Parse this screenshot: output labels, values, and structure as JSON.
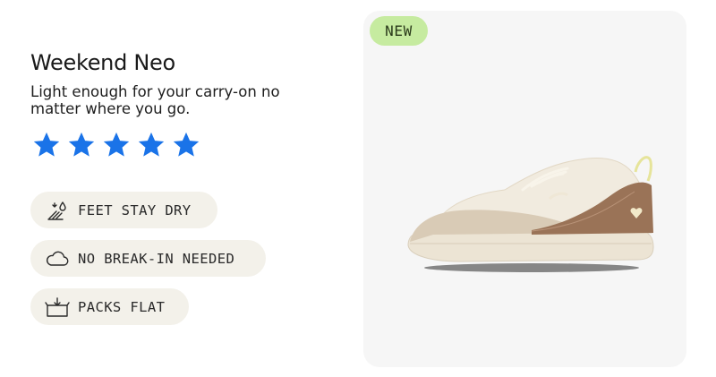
{
  "product": {
    "name": "Weekend Neo",
    "tagline": "Light enough for your carry-on no matter where you go.",
    "rating": {
      "stars": 5,
      "max": 5,
      "color": "#1a73e8"
    },
    "badge": "NEW"
  },
  "features": [
    {
      "icon": "water-drop-icon",
      "label": "FEET STAY DRY"
    },
    {
      "icon": "cloud-icon",
      "label": "NO BREAK-IN NEEDED"
    },
    {
      "icon": "box-icon",
      "label": "PACKS FLAT"
    }
  ],
  "colors": {
    "pill_bg": "#f3f1ea",
    "badge_bg": "#c6eba0",
    "card_bg": "#f6f6f6"
  }
}
